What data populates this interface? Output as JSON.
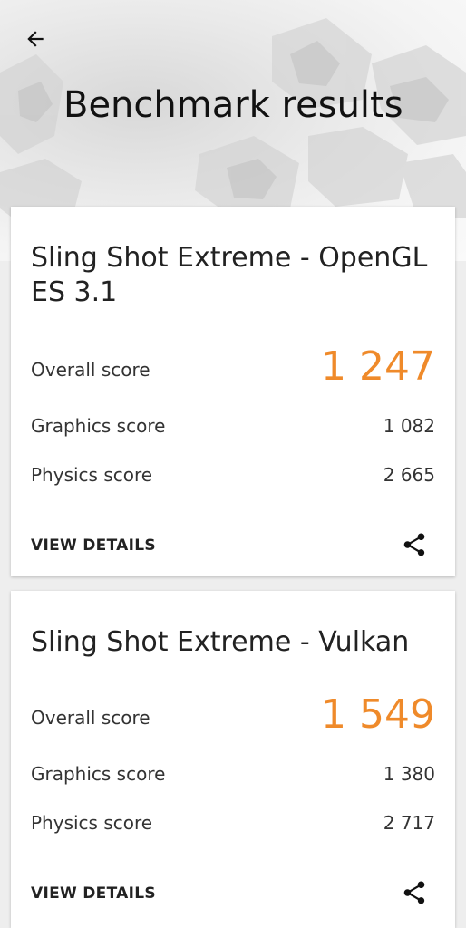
{
  "header": {
    "title": "Benchmark results"
  },
  "results": [
    {
      "title": "Sling Shot Extreme - OpenGL ES 3.1",
      "overall_label": "Overall score",
      "overall_value": "1 247",
      "graphics_label": "Graphics score",
      "graphics_value": "1 082",
      "physics_label": "Physics score",
      "physics_value": "2 665",
      "details_label": "VIEW DETAILS"
    },
    {
      "title": "Sling Shot Extreme - Vulkan",
      "overall_label": "Overall score",
      "overall_value": "1 549",
      "graphics_label": "Graphics score",
      "graphics_value": "1 380",
      "physics_label": "Physics score",
      "physics_value": "2 717",
      "details_label": "VIEW DETAILS"
    }
  ],
  "icons": {
    "back": "arrow-left-icon",
    "share": "share-icon"
  },
  "colors": {
    "accent": "#ef8a2a",
    "card": "#ffffff",
    "background": "#eeeeee"
  }
}
